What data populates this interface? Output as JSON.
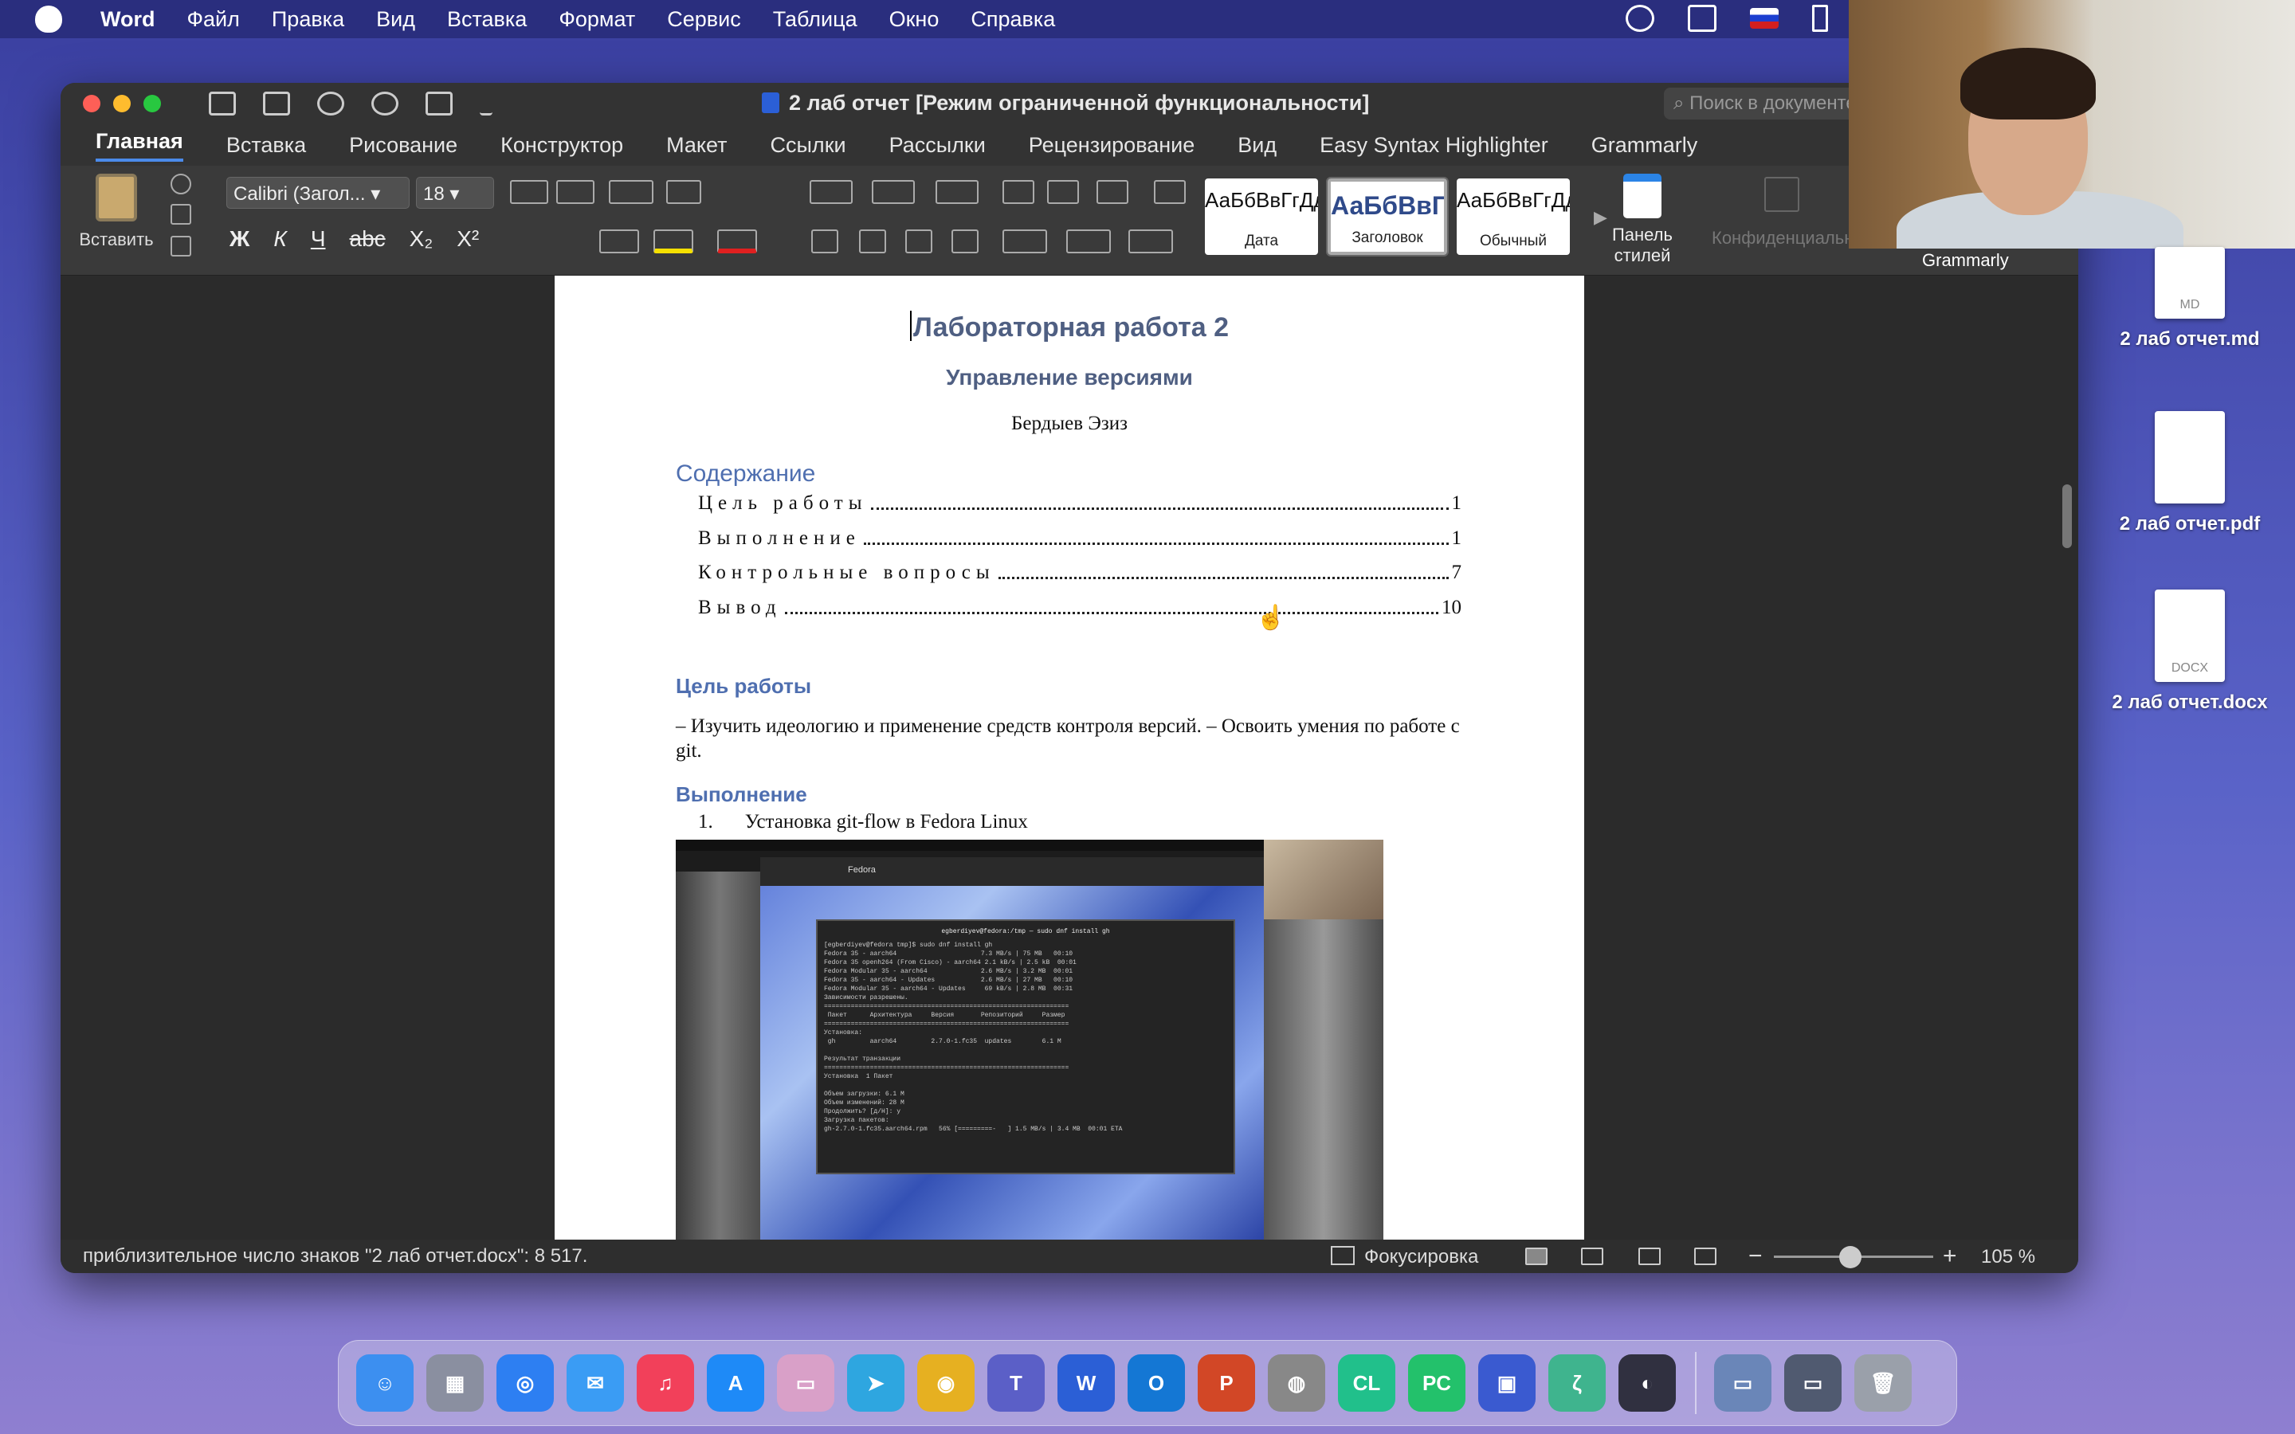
{
  "menubar": {
    "app_name": "Word",
    "items": [
      "Файл",
      "Правка",
      "Вид",
      "Вставка",
      "Формат",
      "Сервис",
      "Таблица",
      "Окно",
      "Справка"
    ]
  },
  "window": {
    "title": "2 лаб отчет [Режим ограниченной функциональности]",
    "search_placeholder": "Поиск в документе",
    "tabs": [
      "Главная",
      "Вставка",
      "Рисование",
      "Конструктор",
      "Макет",
      "Ссылки",
      "Рассылки",
      "Рецензирование",
      "Вид",
      "Easy Syntax Highlighter",
      "Grammarly"
    ],
    "active_tab": "Главная"
  },
  "ribbon": {
    "paste_label": "Вставить",
    "font_name": "Calibri (Загол...",
    "font_size": "18",
    "format_buttons": [
      "Ж",
      "К",
      "Ч",
      "abc",
      "X₂",
      "X²"
    ],
    "styles": [
      {
        "sample": "АаБбВвГгДд",
        "name": "Дата"
      },
      {
        "sample": "АаБбВвГ",
        "name": "Заголовок"
      },
      {
        "sample": "АаБбВвГгДд",
        "name": "Обычный"
      }
    ],
    "styles_panel_label": "Панель стилей",
    "confidential_label": "Конфиденциальн"
  },
  "document": {
    "title": "Лабораторная работа 2",
    "subtitle": "Управление версиями",
    "author": "Бердыев Эзиз",
    "toc_title": "Содержание",
    "toc": [
      {
        "label": "Цель работы",
        "page": "1"
      },
      {
        "label": "Выполнение",
        "page": "1"
      },
      {
        "label": "Контрольные вопросы",
        "page": "7"
      },
      {
        "label": "Вывод",
        "page": "10"
      }
    ],
    "section1_title": "Цель работы",
    "section1_text": "– Изучить идеологию и применение средств контроля версий. – Освоить умения по работе с git.",
    "section2_title": "Выполнение",
    "list_item_num": "1.",
    "list_item_text": "Установка git-flow в Fedora Linux",
    "screenshot_bar_text": "Fedora",
    "screenshot_terminal_title": "egberdiyev@fedora:/tmp — sudo dnf install gh",
    "screenshot_terminal_text": "[egberdiyev@fedora tmp]$ sudo dnf install gh\nFedora 35 - aarch64                      7.3 MB/s | 75 MB   00:10\nFedora 35 openh264 (From Cisco) - aarch64 2.1 kB/s | 2.5 kB  00:01\nFedora Modular 35 - aarch64              2.6 MB/s | 3.2 MB  00:01\nFedora 35 - aarch64 - Updates            2.6 MB/s | 27 MB   00:10\nFedora Modular 35 - aarch64 - Updates     69 kB/s | 2.8 MB  00:31\nЗависимости разрешены.\n================================================================\n Пакет      Архитектура     Версия       Репозиторий     Размер\n================================================================\nУстановка:\n gh         aarch64         2.7.0-1.fc35  updates        6.1 M\n\nРезультат транзакции\n================================================================\nУстановка  1 Пакет\n\nОбъем загрузки: 6.1 M\nОбъем изменений: 28 M\nПродолжить? [д/Н]: y\nЗагрузка пакетов:\ngh-2.7.0-1.fc35.aarch64.rpm   56% [=========-   ] 1.5 MB/s | 3.4 MB  00:01 ETA"
  },
  "statusbar": {
    "char_count": "приблизительное число знаков \"2 лаб отчет.docx\": 8 517.",
    "focus_label": "Фокусировка",
    "zoom": "105 %"
  },
  "webcam": {
    "label": "Grammarly"
  },
  "desktop_files": [
    {
      "name": "2 лаб отчет.md",
      "badge": "MD"
    },
    {
      "name": "2 лаб отчет.pdf",
      "badge": ""
    },
    {
      "name": "2 лаб отчет.docx",
      "badge": "DOCX"
    }
  ],
  "dock": {
    "apps": [
      {
        "name": "Finder",
        "color": "#3c8ff0",
        "glyph": "☺"
      },
      {
        "name": "Launchpad",
        "color": "#8a8fa0",
        "glyph": "▦"
      },
      {
        "name": "Safari",
        "color": "#2d7ff2",
        "glyph": "◎"
      },
      {
        "name": "Mail",
        "color": "#3a9cf4",
        "glyph": "✉"
      },
      {
        "name": "Music",
        "color": "#f2405a",
        "glyph": "♫"
      },
      {
        "name": "App Store",
        "color": "#1e8af7",
        "glyph": "A"
      },
      {
        "name": "Preview",
        "color": "#d9a0c8",
        "glyph": "▭"
      },
      {
        "name": "Telegram",
        "color": "#2ea6e0",
        "glyph": "➤"
      },
      {
        "name": "Chrome",
        "color": "#e6b021",
        "glyph": "◉"
      },
      {
        "name": "Teams",
        "color": "#5b5fc7",
        "glyph": "T"
      },
      {
        "name": "Word",
        "color": "#2b5fd6",
        "glyph": "W"
      },
      {
        "name": "Outlook",
        "color": "#1477d4",
        "glyph": "O"
      },
      {
        "name": "PowerPoint",
        "color": "#d24726",
        "glyph": "P"
      },
      {
        "name": "Disk Utility",
        "color": "#888888",
        "glyph": "◍"
      },
      {
        "name": "CLion",
        "color": "#21c08b",
        "glyph": "CL"
      },
      {
        "name": "PyCharm",
        "color": "#23c16b",
        "glyph": "PC"
      },
      {
        "name": "Parallels",
        "color": "#3a5ad0",
        "glyph": "▣"
      },
      {
        "name": "Zettlr",
        "color": "#3fb48e",
        "glyph": "ζ"
      },
      {
        "name": "OBS",
        "color": "#303040",
        "glyph": "◐"
      }
    ],
    "after_sep": [
      {
        "name": "Downloads",
        "color": "#6a86b8",
        "glyph": "▭"
      },
      {
        "name": "Screenshot",
        "color": "#505a70",
        "glyph": "▭"
      }
    ],
    "trash": {
      "name": "Trash",
      "color": "#9aa0aa",
      "glyph": "🗑"
    }
  }
}
